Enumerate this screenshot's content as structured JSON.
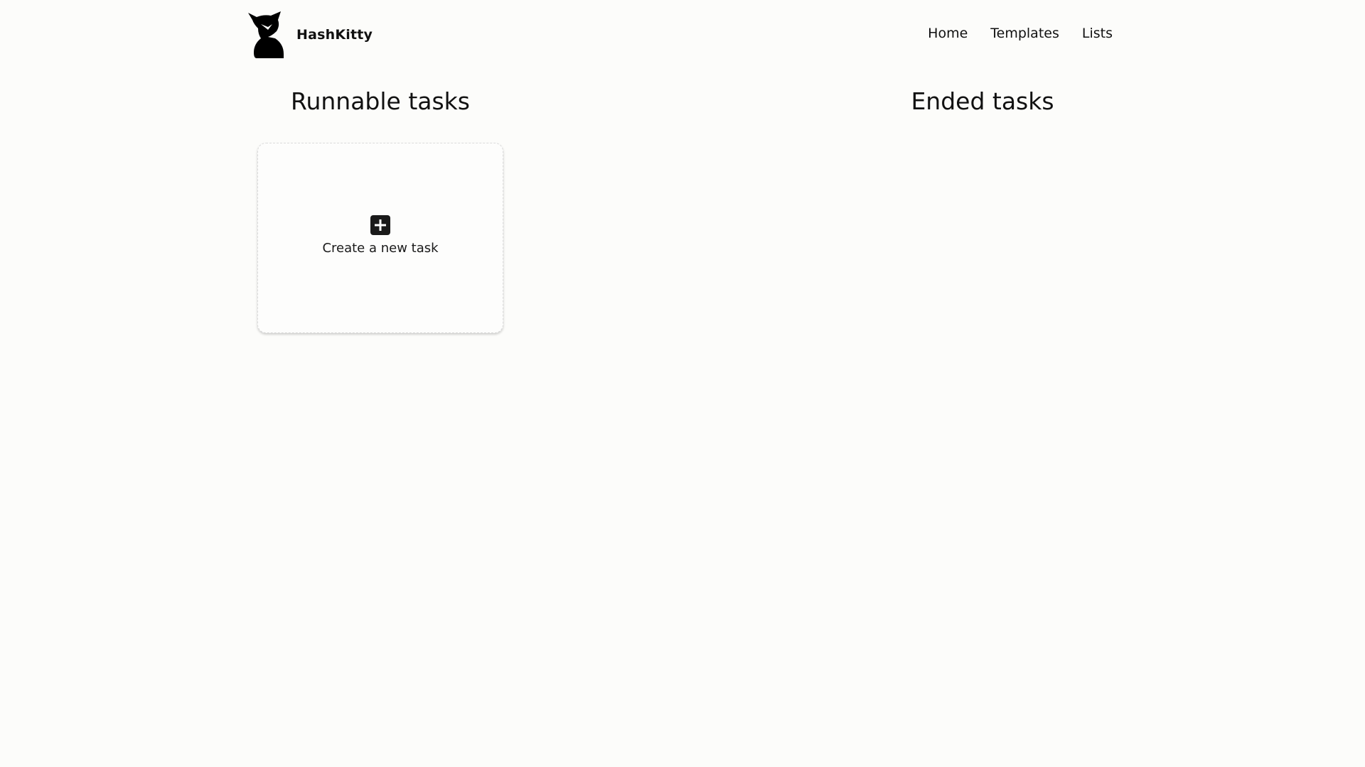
{
  "header": {
    "brand": "HashKitty",
    "logo_icon": "cat-silhouette-icon",
    "nav": [
      {
        "label": "Home"
      },
      {
        "label": "Templates"
      },
      {
        "label": "Lists"
      }
    ]
  },
  "sections": {
    "runnable_title": "Runnable tasks",
    "ended_title": "Ended tasks"
  },
  "create_card": {
    "icon": "plus-square-icon",
    "label": "Create a new task"
  },
  "colors": {
    "background": "#fcfcfa",
    "text": "#111111"
  }
}
